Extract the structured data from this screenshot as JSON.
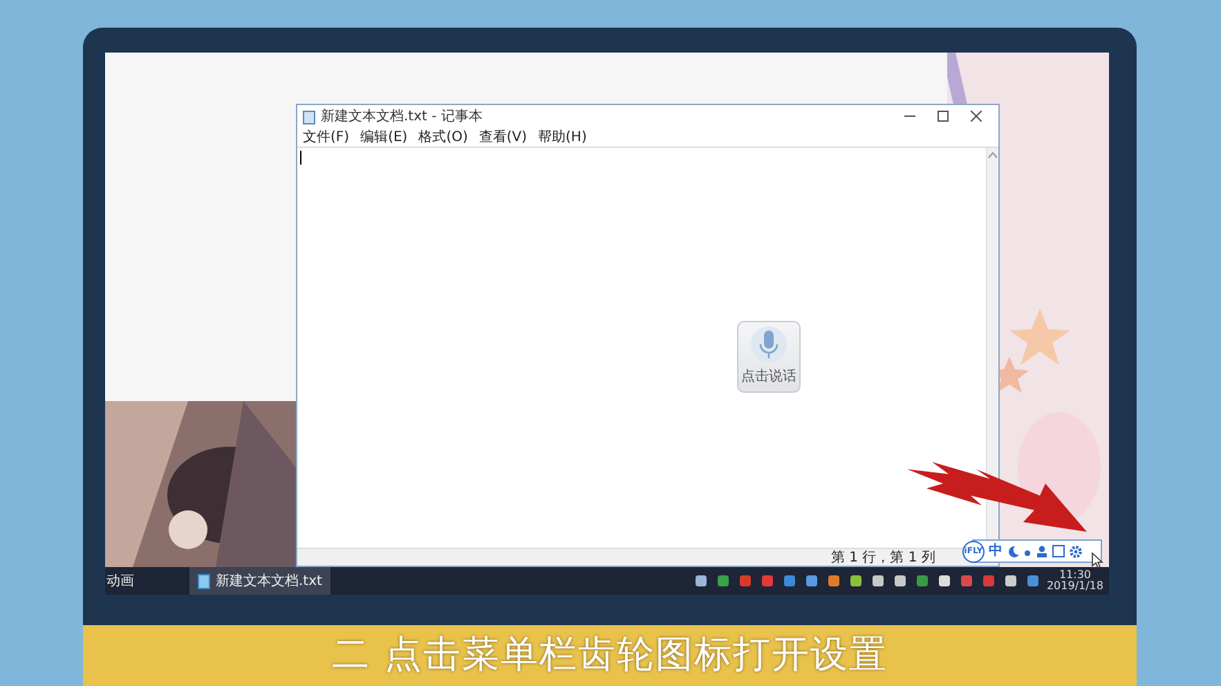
{
  "notepad": {
    "title": "新建文本文档.txt - 记事本",
    "menu": [
      "文件(F)",
      "编辑(E)",
      "格式(O)",
      "查看(V)",
      "帮助(H)"
    ],
    "status": "第 1 行，第 1 列"
  },
  "voice_input": {
    "label": "点击说话"
  },
  "ime_toolbar": {
    "brand": "iFLY",
    "mode": "中"
  },
  "taskbar": {
    "left_label": "动画",
    "items": [
      {
        "label": "新建文本文档.txt"
      }
    ],
    "time": "11:30",
    "date": "2019/1/18"
  },
  "caption": "二 点击菜单栏齿轮图标打开设置"
}
